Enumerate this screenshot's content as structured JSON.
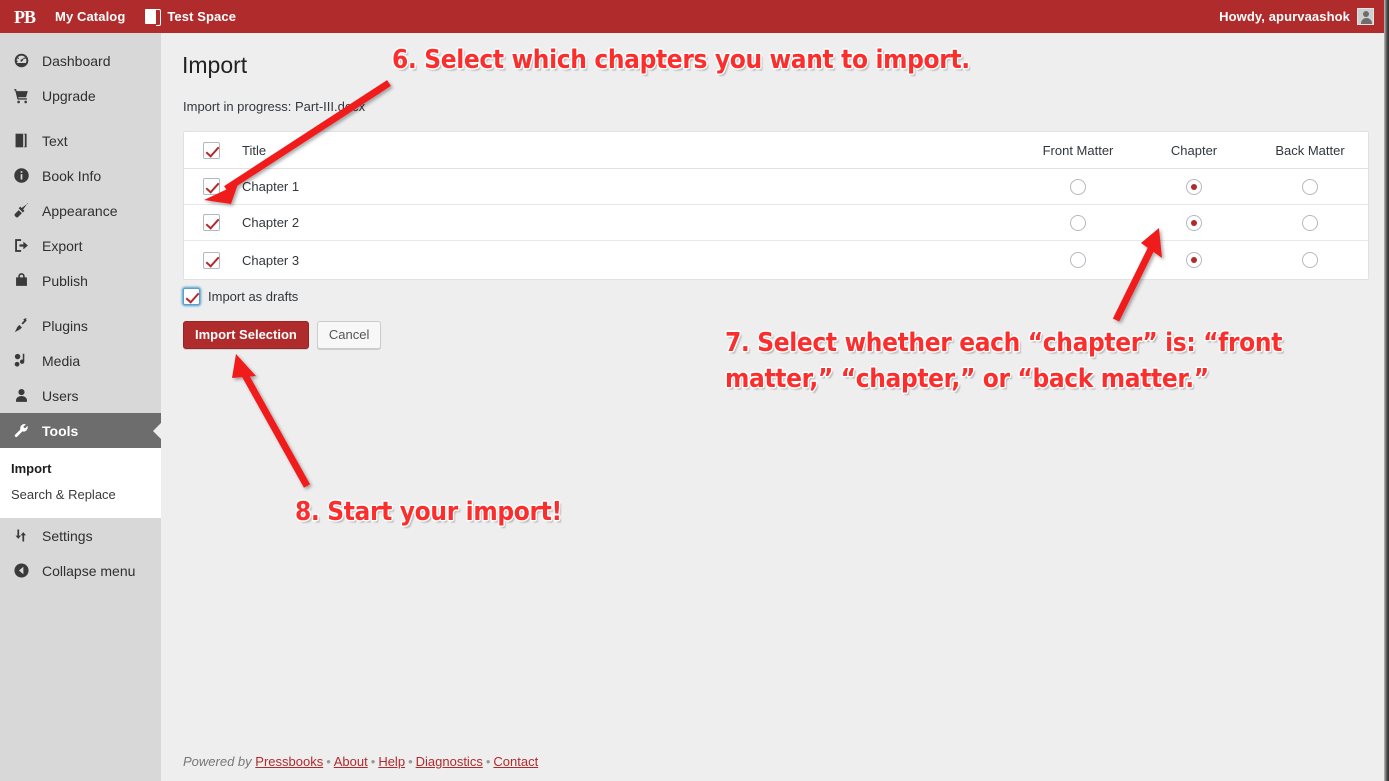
{
  "adminbar": {
    "logo": "PB",
    "logo_icon": "pressbooks-logo-icon",
    "my_catalog": "My Catalog",
    "site_name": "Test Space",
    "site_icon": "book-icon",
    "howdy": "Howdy, apurvaashok",
    "avatar_icon": "avatar-icon",
    "background_color": "#b02b2c"
  },
  "sidebar": {
    "items": [
      {
        "label": "Dashboard",
        "icon": "dashboard-icon",
        "current": false,
        "gap_before": false
      },
      {
        "label": "Upgrade",
        "icon": "cart-icon",
        "current": false,
        "gap_before": false
      },
      {
        "label": "Text",
        "icon": "book-icon",
        "current": false,
        "gap_before": true
      },
      {
        "label": "Book Info",
        "icon": "info-icon",
        "current": false,
        "gap_before": false
      },
      {
        "label": "Appearance",
        "icon": "brush-icon",
        "current": false,
        "gap_before": false
      },
      {
        "label": "Export",
        "icon": "export-icon",
        "current": false,
        "gap_before": false
      },
      {
        "label": "Publish",
        "icon": "bag-icon",
        "current": false,
        "gap_before": false
      },
      {
        "label": "Plugins",
        "icon": "plug-icon",
        "current": false,
        "gap_before": true
      },
      {
        "label": "Media",
        "icon": "media-icon",
        "current": false,
        "gap_before": false
      },
      {
        "label": "Users",
        "icon": "user-icon",
        "current": false,
        "gap_before": false
      },
      {
        "label": "Tools",
        "icon": "wrench-icon",
        "current": true,
        "gap_before": false
      }
    ],
    "submenu": [
      {
        "label": "Import",
        "current": true
      },
      {
        "label": "Search & Replace",
        "current": false
      }
    ],
    "items_after": [
      {
        "label": "Settings",
        "icon": "settings-icon",
        "current": false,
        "gap_before": false
      },
      {
        "label": "Collapse menu",
        "icon": "collapse-icon",
        "current": false,
        "gap_before": false
      }
    ],
    "active_color": "#6d6d6d",
    "background_color": "#d8d8d8"
  },
  "main": {
    "page_title": "Import",
    "import_status": "Import in progress: Part-III.docx",
    "table": {
      "columns": [
        "Title",
        "Front Matter",
        "Chapter",
        "Back Matter"
      ],
      "header_checkbox_checked": true,
      "rows": [
        {
          "title": "Chapter 1",
          "checked": true,
          "selection": "Chapter"
        },
        {
          "title": "Chapter 2",
          "checked": true,
          "selection": "Chapter"
        },
        {
          "title": "Chapter 3",
          "checked": true,
          "selection": "Chapter"
        }
      ]
    },
    "drafts_checkbox": {
      "label": "Import as drafts",
      "checked": true,
      "focused": true
    },
    "buttons": {
      "primary": "Import Selection",
      "secondary": "Cancel"
    }
  },
  "footer": {
    "powered_by": "Powered by",
    "links": [
      "Pressbooks",
      "About",
      "Help",
      "Diagnostics",
      "Contact"
    ],
    "separator": "•"
  },
  "annotations": [
    {
      "id": 6,
      "text": "6. Select which chapters you want to import.",
      "color": "#fb2e2e"
    },
    {
      "id": 7,
      "text": "7. Select whether each “chapter” is: “front\nmatter,” “chapter,” or “back matter.”",
      "color": "#fb2e2e"
    },
    {
      "id": 8,
      "text": "8. Start your import!",
      "color": "#fb2e2e"
    }
  ]
}
